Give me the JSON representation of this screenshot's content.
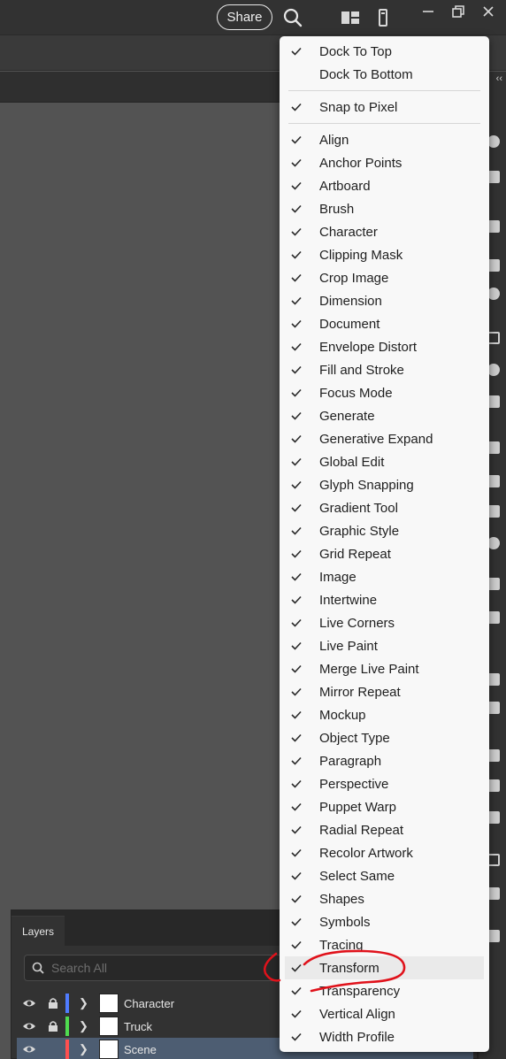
{
  "topbar": {
    "share_label": "Share",
    "icons": [
      "search-icon",
      "arrange-documents-icon",
      "properties-icon",
      "minimize-icon",
      "restore-icon",
      "close-icon"
    ]
  },
  "menu": {
    "dock_group": [
      {
        "label": "Dock To Top",
        "checked": true
      },
      {
        "label": "Dock To Bottom",
        "checked": false
      }
    ],
    "snap_group": [
      {
        "label": "Snap to Pixel",
        "checked": true
      }
    ],
    "items": [
      {
        "label": "Align",
        "checked": true
      },
      {
        "label": "Anchor Points",
        "checked": true
      },
      {
        "label": "Artboard",
        "checked": true
      },
      {
        "label": "Brush",
        "checked": true
      },
      {
        "label": "Character",
        "checked": true
      },
      {
        "label": "Clipping Mask",
        "checked": true
      },
      {
        "label": "Crop Image",
        "checked": true
      },
      {
        "label": "Dimension",
        "checked": true
      },
      {
        "label": "Document",
        "checked": true
      },
      {
        "label": "Envelope Distort",
        "checked": true
      },
      {
        "label": "Fill and Stroke",
        "checked": true
      },
      {
        "label": "Focus Mode",
        "checked": true
      },
      {
        "label": "Generate",
        "checked": true
      },
      {
        "label": "Generative Expand",
        "checked": true
      },
      {
        "label": "Global Edit",
        "checked": true
      },
      {
        "label": "Glyph Snapping",
        "checked": true
      },
      {
        "label": "Gradient Tool",
        "checked": true
      },
      {
        "label": "Graphic Style",
        "checked": true
      },
      {
        "label": "Grid Repeat",
        "checked": true
      },
      {
        "label": "Image",
        "checked": true
      },
      {
        "label": "Intertwine",
        "checked": true
      },
      {
        "label": "Live Corners",
        "checked": true
      },
      {
        "label": "Live Paint",
        "checked": true
      },
      {
        "label": "Merge Live Paint",
        "checked": true
      },
      {
        "label": "Mirror Repeat",
        "checked": true
      },
      {
        "label": "Mockup",
        "checked": true
      },
      {
        "label": "Object Type",
        "checked": true
      },
      {
        "label": "Paragraph",
        "checked": true
      },
      {
        "label": "Perspective",
        "checked": true
      },
      {
        "label": "Puppet Warp",
        "checked": true
      },
      {
        "label": "Radial Repeat",
        "checked": true
      },
      {
        "label": "Recolor Artwork",
        "checked": true
      },
      {
        "label": "Select Same",
        "checked": true
      },
      {
        "label": "Shapes",
        "checked": true
      },
      {
        "label": "Symbols",
        "checked": true
      },
      {
        "label": "Tracing",
        "checked": true
      },
      {
        "label": "Transform",
        "checked": true,
        "highlighted": true
      },
      {
        "label": "Transparency",
        "checked": true
      },
      {
        "label": "Vertical Align",
        "checked": true
      },
      {
        "label": "Width Profile",
        "checked": true
      }
    ]
  },
  "layers": {
    "tab_label": "Layers",
    "search_placeholder": "Search All",
    "rows": [
      {
        "name": "Character",
        "color": "#4f7cff",
        "locked": true,
        "selected": false
      },
      {
        "name": "Truck",
        "color": "#4fdc4f",
        "locked": true,
        "selected": false
      },
      {
        "name": "Scene",
        "color": "#ff4f4f",
        "locked": false,
        "selected": true
      }
    ]
  },
  "colors": {
    "annotation": "#e0121b",
    "menu_bg": "#f8f8f8",
    "app_bg": "#535353"
  }
}
